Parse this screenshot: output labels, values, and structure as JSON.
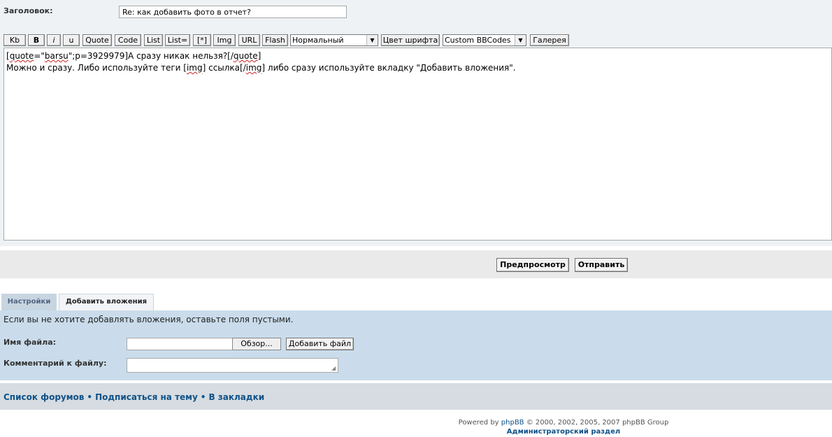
{
  "subject": {
    "label": "Заголовок:",
    "value": "Re: как добавить фото в отчет?"
  },
  "toolbar": {
    "buttons": [
      "Kb",
      "B",
      "i",
      "u",
      "Quote",
      "Code",
      "List",
      "List=",
      "[*]",
      "Img",
      "URL",
      "Flash"
    ],
    "font_size_select": "Нормальный",
    "font_color_button": "Цвет шрифта",
    "custom_bbcodes_select": "Custom BBCodes",
    "gallery_button": "Галерея"
  },
  "editor": {
    "line1_part1": "[",
    "line1_quote_tag": "quote",
    "line1_part2": "=\"",
    "line1_user": "barsu",
    "line1_part3": "\";p=3929979]А сразу никак нельзя?[/",
    "line1_quote_close": "quote",
    "line1_part4": "]",
    "line2_part1": "Можно и сразу. Либо используйте теги [",
    "line2_img1": "img",
    "line2_part2": "] ссылка[/",
    "line2_img2": "img",
    "line2_part3": "] либо сразу используйте вкладку \"Добавить вложения\"."
  },
  "submit": {
    "preview_label": "Предпросмотр",
    "send_label": "Отправить"
  },
  "tabs": [
    {
      "label": "Настройки",
      "active": false
    },
    {
      "label": "Добавить вложения",
      "active": true
    }
  ],
  "attachments": {
    "hint": "Если вы не хотите добавлять вложения, оставьте поля пустыми.",
    "filename_label": "Имя файла:",
    "browse_label": "Обзор...",
    "add_file_label": "Добавить файл",
    "comment_label": "Комментарий к файлу:"
  },
  "nav": {
    "forum_list": "Список форумов",
    "subscribe": "Подписаться на тему",
    "bookmarks": "В закладки",
    "separator": "•"
  },
  "footer": {
    "powered_prefix": "Powered by ",
    "phpbb_link": "phpBB",
    "powered_suffix": " © 2000, 2002, 2005, 2007 phpBB Group",
    "admin_link": "Администраторский раздел"
  },
  "colors": {
    "link": "#105289",
    "attach_panel": "#cadceb",
    "tab_inactive": "#c7d5e0",
    "nav_bar": "#d6dce1"
  }
}
